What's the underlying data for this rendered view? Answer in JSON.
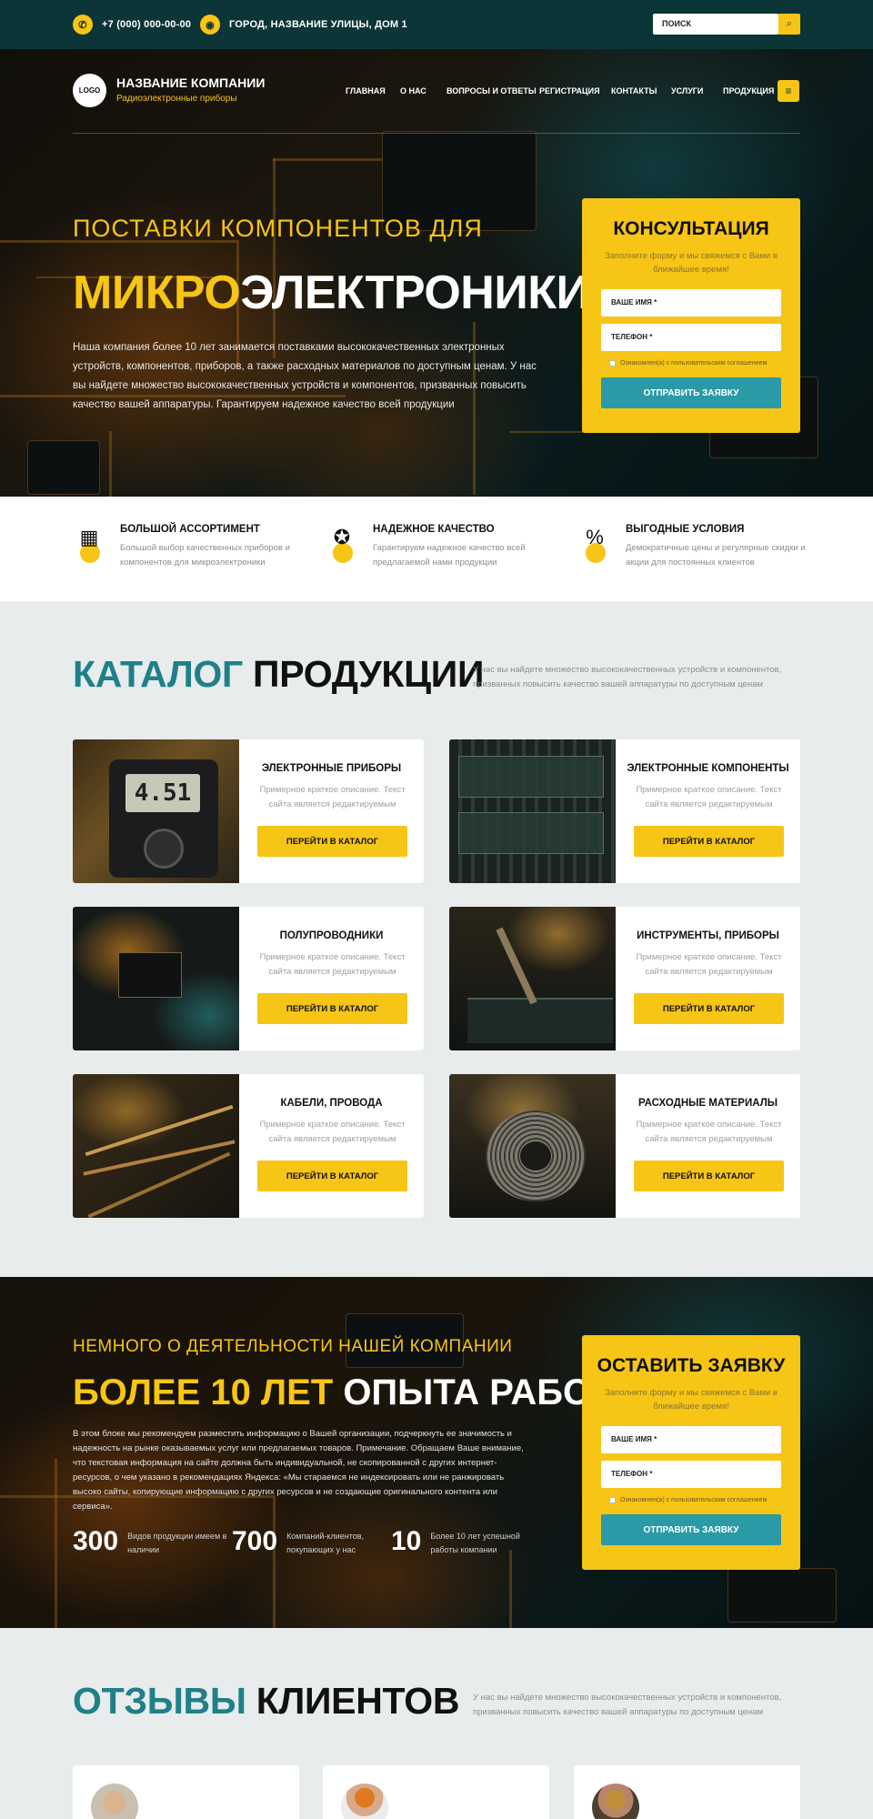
{
  "topbar": {
    "phone": "+7 (000) 000-00-00",
    "address": "ГОРОД, НАЗВАНИЕ УЛИЦЫ, ДОМ 1",
    "search_placeholder": "ПОИСК"
  },
  "header": {
    "logo_text": "LOGO",
    "company_name": "НАЗВАНИЕ КОМПАНИИ",
    "company_sub": "Радиоэлектронные приборы",
    "nav": [
      "ГЛАВНАЯ",
      "О НАС",
      "ВОПРОСЫ И ОТВЕТЫ",
      "РЕГИСТРАЦИЯ",
      "КОНТАКТЫ",
      "УСЛУГИ",
      "ПРОДУКЦИЯ"
    ],
    "menu_icon": "menu-icon"
  },
  "hero": {
    "kicker": "ПОСТАВКИ КОМПОНЕНТОВ ДЛЯ",
    "title_accent": "МИКРО",
    "title_rest": "ЭЛЕКТРОНИКИ",
    "text": "Наша компания более 10 лет занимается поставками высококачественных электронных устройств, компонентов, приборов, а также расходных материалов по доступным ценам. У нас вы найдете множество высококачественных устройств и компонентов, призванных повысить качество вашей аппаратуры. Гарантируем надежное качество всей продукции"
  },
  "consult_form": {
    "title": "КОНСУЛЬТАЦИЯ",
    "subtitle": "Заполните форму и мы свяжемся с Вами в ближайшее время!",
    "name_placeholder": "ВАШЕ ИМЯ *",
    "phone_placeholder": "ТЕЛЕФОН *",
    "agree": "Ознакомлен(а) с пользовательским соглашением",
    "submit": "ОТПРАВИТЬ ЗАЯВКУ"
  },
  "features": [
    {
      "icon": "chip-icon",
      "title": "БОЛЬШОЙ АССОРТИМЕНТ",
      "text": "Большой выбор качественных приборов и компонентов для микроэлектроники"
    },
    {
      "icon": "award-icon",
      "title": "НАДЕЖНОЕ КАЧЕСТВО",
      "text": "Гарантируем надежное качество всей предлагаемой нами продукции"
    },
    {
      "icon": "percent-badge-icon",
      "title": "ВЫГОДНЫЕ УСЛОВИЯ",
      "text": "Демократичные цены и регулярные скидки и акции для постоянных клиентов"
    }
  ],
  "catalog": {
    "title_accent": "КАТАЛОГ",
    "title_rest": " ПРОДУКЦИИ",
    "desc": "У нас вы найдете множество высококачественных устройств и компонентов, призванных повысить качество вашей аппаратуры по доступным ценам",
    "items": [
      {
        "title": "ЭЛЕКТРОННЫЕ ПРИБОРЫ",
        "desc": "Примерное краткое описание. Текст сайта является редактируемым",
        "button": "ПЕРЕЙТИ В КАТАЛОГ",
        "image": "multimeter"
      },
      {
        "title": "ЭЛЕКТРОННЫЕ КОМПОНЕНТЫ",
        "desc": "Примерное краткое описание. Текст сайта является редактируемым",
        "button": "ПЕРЕЙТИ В КАТАЛОГ",
        "image": "circuit-boards"
      },
      {
        "title": "ПОЛУПРОВОДНИКИ",
        "desc": "Примерное краткое описание. Текст сайта является редактируемым",
        "button": "ПЕРЕЙТИ В КАТАЛОГ",
        "image": "semiconductors"
      },
      {
        "title": "ИНСТРУМЕНТЫ, ПРИБОРЫ",
        "desc": "Примерное краткое описание. Текст сайта является редактируемым",
        "button": "ПЕРЕЙТИ В КАТАЛОГ",
        "image": "soldering"
      },
      {
        "title": "КАБЕЛИ, ПРОВОДА",
        "desc": "Примерное краткое описание. Текст сайта является редактируемым",
        "button": "ПЕРЕЙТИ В КАТАЛОГ",
        "image": "cables"
      },
      {
        "title": "РАСХОДНЫЕ МАТЕРИАЛЫ",
        "desc": "Примерное краткое описание. Текст сайта является редактируемым",
        "button": "ПЕРЕЙТИ В КАТАЛОГ",
        "image": "solder-wire"
      }
    ]
  },
  "about": {
    "kicker": "НЕМНОГО О ДЕЯТЕЛЬНОСТИ НАШЕЙ КОМПАНИИ",
    "title_accent": "БОЛЕЕ 10 ЛЕТ",
    "title_rest": " ОПЫТА РАБОТЫ",
    "text": "В этом блоке мы рекомендуем разместить информацию о Вашей организации, подчеркнуть ее значимость и надежность на рынке оказываемых услуг или предлагаемых товаров. Примечание. Обращаем Ваше внимание, что текстовая информация на сайте должна быть индивидуальной, не скопированной с других интернет-ресурсов, о чем указано в рекомендациях Яндекса: «Мы стараемся не индексировать или не ранжировать высоко сайты, копирующие информацию с других ресурсов и не создающие оригинального контента или сервиса».",
    "stats": [
      {
        "num": "300",
        "label": "Видов продукции имеем в наличии"
      },
      {
        "num": "700",
        "label": "Компаний-клиентов, покупающих у нас"
      },
      {
        "num": "10",
        "label": "Более 10 лет успешной работы компании"
      }
    ]
  },
  "request_form": {
    "title": "ОСТАВИТЬ ЗАЯВКУ",
    "subtitle": "Заполните форму и мы свяжемся с Вами в ближайшее время!",
    "name_placeholder": "ВАШЕ ИМЯ *",
    "phone_placeholder": "ТЕЛЕФОН *",
    "agree": "Ознакомлен(а) с пользовательским соглашением",
    "submit": "ОТПРАВИТЬ ЗАЯВКУ"
  },
  "reviews": {
    "title_accent": "ОТЗЫВЫ",
    "title_rest": " КЛИЕНТОВ",
    "desc": "У нас вы найдете множество высококачественных устройств и компонентов, призванных повысить качество вашей аппаратуры по доступным ценам"
  },
  "colors": {
    "accent": "#f7c515",
    "teal": "#1f8089",
    "button_teal": "#2a9aa6",
    "topbar": "#0c3538"
  }
}
